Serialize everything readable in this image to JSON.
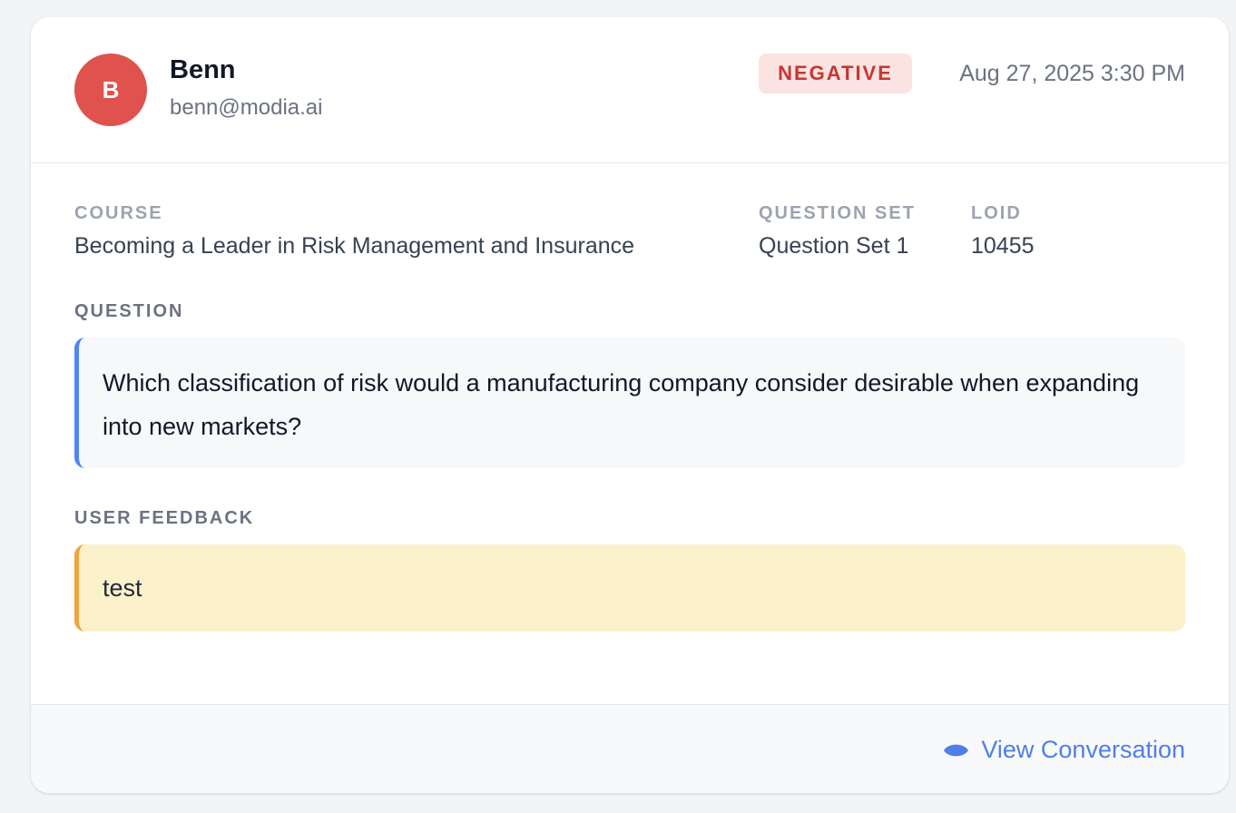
{
  "user": {
    "avatar_initial": "B",
    "name": "Benn",
    "email": "benn@modia.ai"
  },
  "sentiment": {
    "label": "NEGATIVE",
    "color": "#c83532",
    "bg_color": "#fbe3e1"
  },
  "timestamp": "Aug 27, 2025 3:30 PM",
  "meta": {
    "course_label": "COURSE",
    "course_value": "Becoming a Leader in Risk Management and Insurance",
    "question_set_label": "QUESTION SET",
    "question_set_value": "Question Set 1",
    "loid_label": "LOID",
    "loid_value": "10455"
  },
  "question": {
    "label": "QUESTION",
    "text": "Which classification of risk would a manufacturing company consider desirable when expanding into new markets?",
    "accent_color": "#4f86f7"
  },
  "feedback": {
    "label": "USER FEEDBACK",
    "text": "test",
    "accent_color": "#f0a33a"
  },
  "footer": {
    "view_conversation_label": "View Conversation",
    "link_color": "#4f7fe8",
    "icon": "eye-icon"
  }
}
